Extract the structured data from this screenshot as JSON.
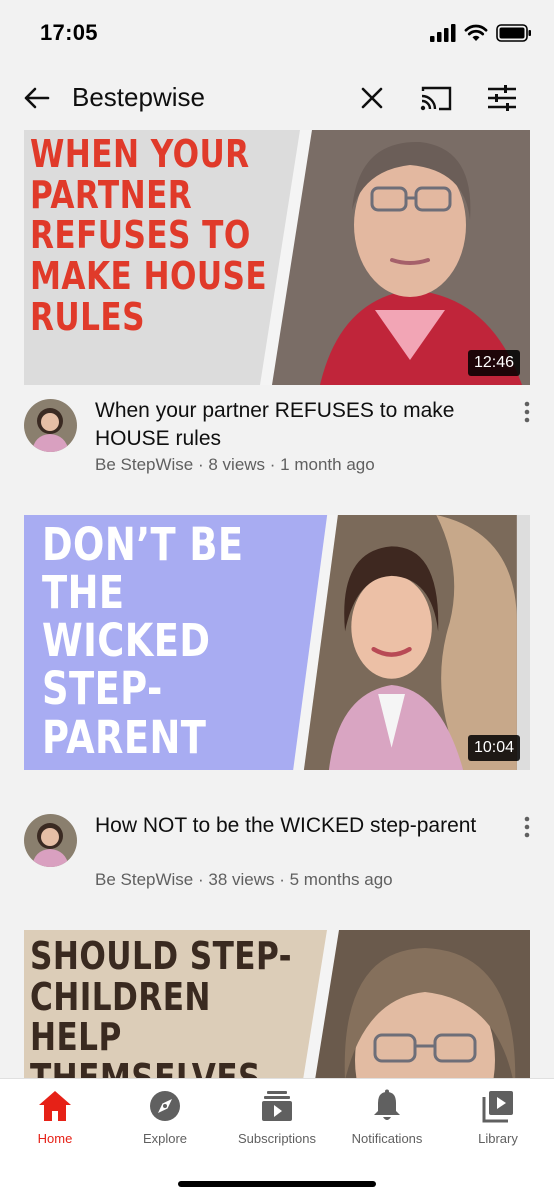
{
  "status_bar": {
    "time": "17:05"
  },
  "search": {
    "query": "Bestepwise"
  },
  "videos": [
    {
      "thumb_text": "When your\npartner\nrefuses to\nmake house\nrules",
      "duration": "12:46",
      "title": "When your partner REFUSES to make HOUSE rules",
      "channel_line": "Be StepWise · 8 views · 1 month ago"
    },
    {
      "thumb_text": "Don’t be\nthe\nwicked\nstep-\nparent",
      "duration": "10:04",
      "title": "How NOT to be the WICKED step-parent",
      "channel_line": "Be StepWise · 38 views · 5 months ago"
    },
    {
      "thumb_text": "Should step-\nchildren\nhelp\nthemselves"
    }
  ],
  "bottom_nav": {
    "home": "Home",
    "explore": "Explore",
    "subscriptions": "Subscriptions",
    "notifications": "Notifications",
    "library": "Library"
  },
  "colors": {
    "active_red": "#e62117",
    "thumb1_text": "#e03a2a",
    "thumb2_panel": "#a8acf2",
    "thumb3_text": "#3a2a20"
  },
  "icons": [
    "back-arrow-icon",
    "clear-icon",
    "cast-icon",
    "filter-icon",
    "more-vert-icon",
    "home-icon",
    "explore-icon",
    "subscriptions-icon",
    "notifications-icon",
    "library-icon"
  ]
}
